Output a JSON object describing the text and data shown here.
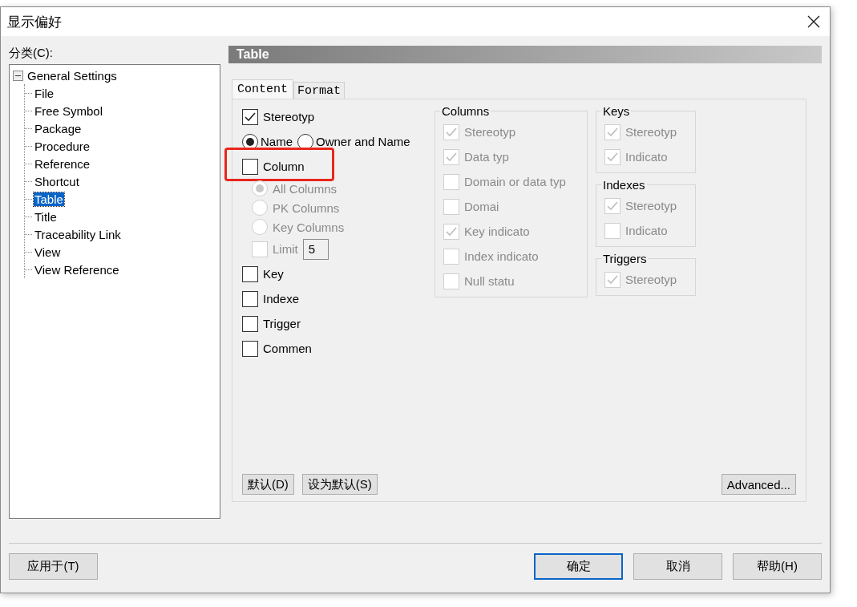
{
  "window": {
    "title": "显示偏好"
  },
  "category_label": "分类(C):",
  "tree": {
    "label": "General Settings",
    "expanded": true,
    "children": [
      {
        "label": "File",
        "selected": false
      },
      {
        "label": "Free Symbol",
        "selected": false
      },
      {
        "label": "Package",
        "selected": false
      },
      {
        "label": "Procedure",
        "selected": false
      },
      {
        "label": "Reference",
        "selected": false
      },
      {
        "label": "Shortcut",
        "selected": false
      },
      {
        "label": "Table",
        "selected": true
      },
      {
        "label": "Title",
        "selected": false
      },
      {
        "label": "Traceability Link",
        "selected": false
      },
      {
        "label": "View",
        "selected": false
      },
      {
        "label": "View Reference",
        "selected": false
      }
    ]
  },
  "panel_title": "Table",
  "tabs": [
    {
      "label": "Content",
      "selected": true
    },
    {
      "label": "Format",
      "selected": false
    }
  ],
  "options": [
    {
      "kind": "checkbox",
      "label": "Stereotyp",
      "checked": true,
      "disabled": false,
      "highlighted": false
    },
    {
      "kind": "radios",
      "items": [
        {
          "label": "Name",
          "selected": true,
          "disabled": false
        },
        {
          "label": "Owner and Name",
          "selected": false,
          "disabled": false
        }
      ]
    },
    {
      "kind": "checkbox",
      "label": "Column",
      "checked": false,
      "disabled": false,
      "highlighted": true
    },
    {
      "kind": "radio",
      "label": "All Columns",
      "selected": true,
      "disabled": true
    },
    {
      "kind": "radio",
      "label": "PK Columns",
      "selected": false,
      "disabled": true
    },
    {
      "kind": "radio",
      "label": "Key Columns",
      "selected": false,
      "disabled": true
    },
    {
      "kind": "limit",
      "label": "Limit",
      "checked": false,
      "disabled": true,
      "value": "5"
    },
    {
      "kind": "checkbox",
      "label": "Key",
      "checked": false,
      "disabled": false,
      "highlighted": false
    },
    {
      "kind": "checkbox",
      "label": "Indexe",
      "checked": false,
      "disabled": false,
      "highlighted": false
    },
    {
      "kind": "checkbox",
      "label": "Trigger",
      "checked": false,
      "disabled": false,
      "highlighted": false
    },
    {
      "kind": "checkbox",
      "label": "Commen",
      "checked": false,
      "disabled": false,
      "highlighted": false
    }
  ],
  "groups": [
    {
      "title": "Columns",
      "items": [
        {
          "label": "Stereotyp",
          "checked": true,
          "disabled": true
        },
        {
          "label": "Data typ",
          "checked": true,
          "disabled": true
        },
        {
          "label": "Domain or data typ",
          "checked": false,
          "disabled": true
        },
        {
          "label": "Domai",
          "checked": false,
          "disabled": true
        },
        {
          "label": "Key indicato",
          "checked": true,
          "disabled": true
        },
        {
          "label": "Index indicato",
          "checked": false,
          "disabled": true
        },
        {
          "label": "Null statu",
          "checked": false,
          "disabled": true
        }
      ]
    },
    {
      "title": "Keys",
      "items": [
        {
          "label": "Stereotyp",
          "checked": true,
          "disabled": true
        },
        {
          "label": "Indicato",
          "checked": true,
          "disabled": true
        }
      ]
    },
    {
      "title": "Indexes",
      "items": [
        {
          "label": "Stereotyp",
          "checked": true,
          "disabled": true
        },
        {
          "label": "Indicato",
          "checked": false,
          "disabled": true
        }
      ]
    },
    {
      "title": "Triggers",
      "items": [
        {
          "label": "Stereotyp",
          "checked": true,
          "disabled": true
        }
      ]
    }
  ],
  "panel_buttons": [
    {
      "label": "默认(D)"
    },
    {
      "label": "设为默认(S)"
    }
  ],
  "advanced_button": "Advanced...",
  "apply_button": "应用于(T)",
  "dialog_buttons": [
    {
      "label": "确定",
      "default": true
    },
    {
      "label": "取消",
      "default": false
    },
    {
      "label": "帮助(H)",
      "default": false
    }
  ]
}
